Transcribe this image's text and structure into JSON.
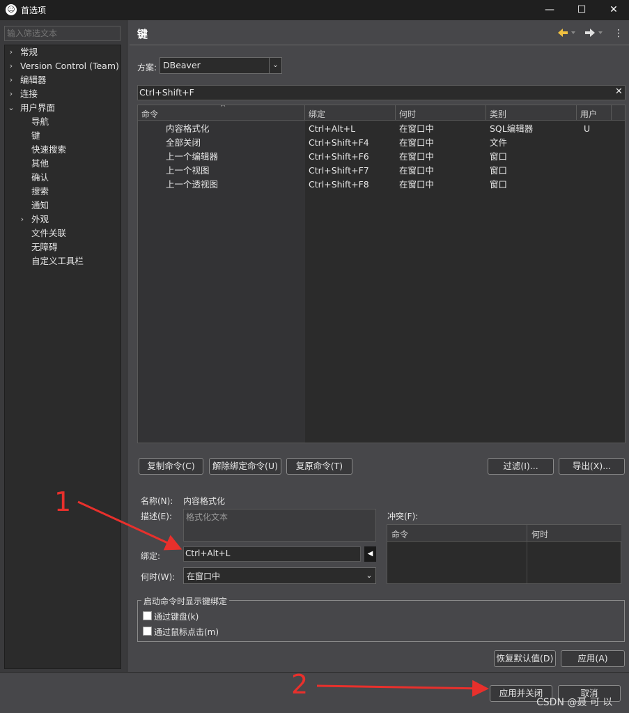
{
  "window": {
    "title": "首选项",
    "app_icon_glyph": "☺",
    "minimize": "—",
    "maximize": "☐",
    "close": "✕"
  },
  "sidebar": {
    "filter_placeholder": "输入筛选文本",
    "items": [
      {
        "label": "常规",
        "expandable": true
      },
      {
        "label": "Version Control (Team)",
        "expandable": true
      },
      {
        "label": "编辑器",
        "expandable": true
      },
      {
        "label": "连接",
        "expandable": true
      },
      {
        "label": "用户界面",
        "expanded": true
      },
      {
        "label": "导航"
      },
      {
        "label": "键",
        "selected": true
      },
      {
        "label": "快速搜索"
      },
      {
        "label": "其他"
      },
      {
        "label": "确认"
      },
      {
        "label": "搜索"
      },
      {
        "label": "通知"
      },
      {
        "label": "外观",
        "expandable": true
      },
      {
        "label": "文件关联"
      },
      {
        "label": "无障碍"
      },
      {
        "label": "自定义工具栏"
      }
    ]
  },
  "page": {
    "title": "键",
    "back_icon": "arrow-left-icon",
    "forward_icon": "arrow-right-icon",
    "menu_icon": "more-vertical-icon"
  },
  "scheme": {
    "label": "方案:",
    "value": "DBeaver"
  },
  "search": {
    "value": "Ctrl+Shift+F"
  },
  "keys_table": {
    "columns": [
      "命令",
      "绑定",
      "何时",
      "类别",
      "用户"
    ],
    "rows": [
      [
        "内容格式化",
        "Ctrl+Alt+L",
        "在窗口中",
        "SQL编辑器",
        "U"
      ],
      [
        "全部关闭",
        "Ctrl+Shift+F4",
        "在窗口中",
        "文件",
        ""
      ],
      [
        "上一个编辑器",
        "Ctrl+Shift+F6",
        "在窗口中",
        "窗口",
        ""
      ],
      [
        "上一个视图",
        "Ctrl+Shift+F7",
        "在窗口中",
        "窗口",
        ""
      ],
      [
        "上一个透视图",
        "Ctrl+Shift+F8",
        "在窗口中",
        "窗口",
        ""
      ]
    ]
  },
  "actions": {
    "copy": "复制命令(C)",
    "unbind": "解除绑定命令(U)",
    "restore": "复原命令(T)",
    "filter": "过滤(I)...",
    "export": "导出(X)..."
  },
  "details": {
    "name_label": "名称(N):",
    "name_value": "内容格式化",
    "desc_label": "描述(E):",
    "desc_value": "格式化文本",
    "binding_label": "绑定:",
    "binding_value": "Ctrl+Alt+L",
    "when_label": "何时(W):",
    "when_value": "在窗口中",
    "conflict_label": "冲突(F):",
    "conflict_columns": [
      "命令",
      "何时"
    ]
  },
  "launch_group": {
    "title": "启动命令时显示键绑定",
    "via_keyboard": "通过键盘(k)",
    "via_mouse": "通过鼠标点击(m)"
  },
  "page_buttons": {
    "restore_defaults": "恢复默认值(D)",
    "apply": "应用(A)"
  },
  "footer": {
    "apply_close": "应用并关闭",
    "cancel": "取消"
  },
  "annotations": {
    "one": "1",
    "two": "2",
    "color": "#e8302c"
  },
  "watermark": "CSDN @聂 可 以"
}
